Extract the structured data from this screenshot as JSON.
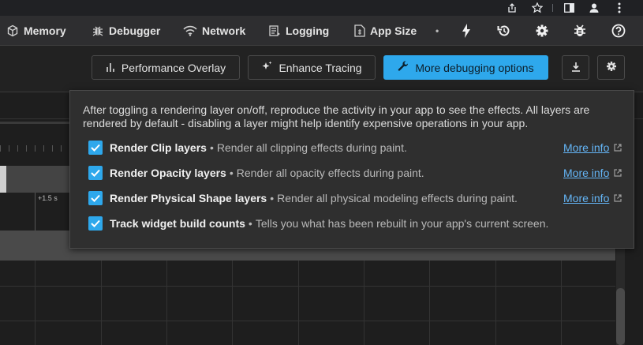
{
  "nav": {
    "tabs": [
      {
        "label": "Memory",
        "icon": "memory-icon"
      },
      {
        "label": "Debugger",
        "icon": "bug-icon"
      },
      {
        "label": "Network",
        "icon": "wifi-icon"
      },
      {
        "label": "Logging",
        "icon": "logging-icon"
      },
      {
        "label": "App Size",
        "icon": "app-size-icon"
      }
    ],
    "more_dot": "•"
  },
  "toolbar": {
    "performance_overlay": "Performance Overlay",
    "enhance_tracing": "Enhance Tracing",
    "more_debugging": "More debugging options"
  },
  "timeline": {
    "marker": "+1.5 s"
  },
  "popup": {
    "description": "After toggling a rendering layer on/off, reproduce the activity in your app to see the effects. All layers are rendered by default - disabling a layer might help identify expensive operations in your app.",
    "options": [
      {
        "name": "Render Clip layers",
        "sub": "Render all clipping effects during paint.",
        "checked": true,
        "more": "More info"
      },
      {
        "name": "Render Opacity layers",
        "sub": "Render all opacity effects during paint.",
        "checked": true,
        "more": "More info"
      },
      {
        "name": "Render Physical Shape layers",
        "sub": "Render all physical modeling effects during paint.",
        "checked": true,
        "more": "More info"
      },
      {
        "name": "Track widget build counts",
        "sub": "Tells you what has been rebuilt in your app's current screen.",
        "checked": true,
        "more": ""
      }
    ],
    "separator": "•"
  },
  "colors": {
    "accent": "#2ea8ec",
    "link": "#64b5f6"
  }
}
